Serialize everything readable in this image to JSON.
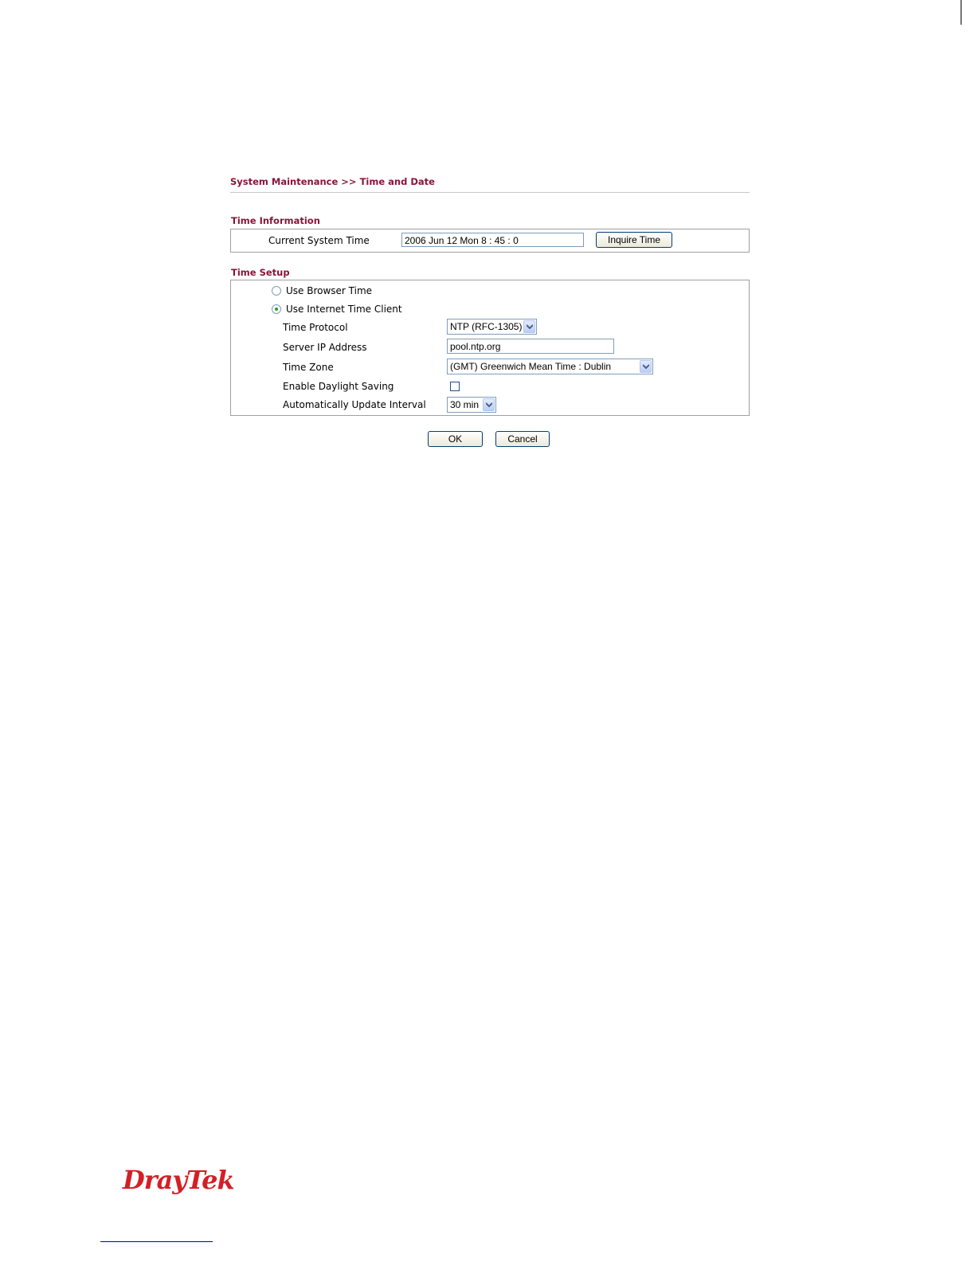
{
  "breadcrumb": "System Maintenance >> Time and Date",
  "time_information": {
    "title": "Time Information",
    "current_label": "Current System Time",
    "current_value": "2006 Jun 12 Mon 8 : 45 : 0",
    "inquire_button": "Inquire Time"
  },
  "time_setup": {
    "title": "Time Setup",
    "radio_browser": "Use Browser Time",
    "radio_internet": "Use Internet Time Client",
    "selected_mode": "internet",
    "protocol_label": "Time Protocol",
    "protocol_value": "NTP (RFC-1305)",
    "server_label": "Server IP Address",
    "server_value": "pool.ntp.org",
    "timezone_label": "Time Zone",
    "timezone_value": "(GMT) Greenwich Mean Time : Dublin",
    "daylight_label": "Enable Daylight Saving",
    "daylight_checked": false,
    "interval_label": "Automatically Update Interval",
    "interval_value": "30 min"
  },
  "buttons": {
    "ok": "OK",
    "cancel": "Cancel"
  },
  "logo_text": "DrayTek",
  "colors": {
    "heading": "#8a1538",
    "logo": "#d41f26"
  }
}
